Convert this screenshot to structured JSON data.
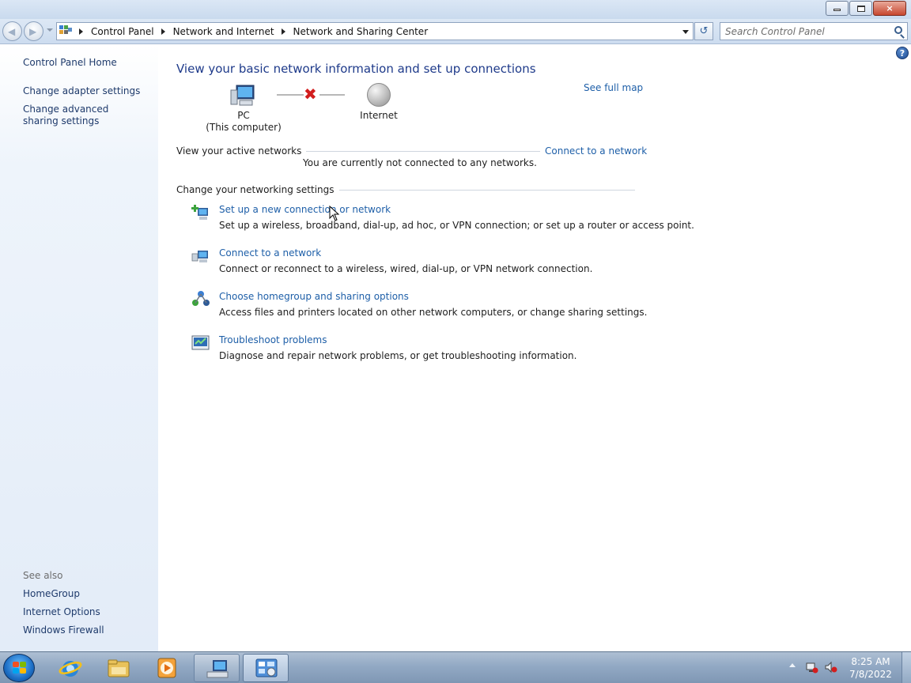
{
  "window": {
    "minimize_icon": "minimize-icon",
    "maximize_icon": "restore-icon",
    "close_label": "×"
  },
  "nav": {
    "back_icon": "back-arrow-icon",
    "forward_icon": "forward-arrow-icon",
    "breadcrumb": [
      "Control Panel",
      "Network and Internet",
      "Network and Sharing Center"
    ],
    "refresh_label": "↺",
    "search_placeholder": "Search Control Panel"
  },
  "sidebar": {
    "home": "Control Panel Home",
    "links": [
      "Change adapter settings",
      "Change advanced sharing settings"
    ],
    "see_also_label": "See also",
    "see_also": [
      "HomeGroup",
      "Internet Options",
      "Windows Firewall"
    ]
  },
  "main": {
    "help_label": "?",
    "title": "View your basic network information and set up connections",
    "see_full_map": "See full map",
    "map": {
      "pc_label": "PC",
      "pc_sublabel": "(This computer)",
      "status_icon": "✖",
      "internet_label": "Internet"
    },
    "active_networks": {
      "label": "View your active networks",
      "connect_link": "Connect to a network",
      "status": "You are currently not connected to any networks."
    },
    "settings_label": "Change your networking settings",
    "tasks": [
      {
        "icon": "new-connection-icon",
        "title": "Set up a new connection or network",
        "description": "Set up a wireless, broadband, dial-up, ad hoc, or VPN connection; or set up a router or access point."
      },
      {
        "icon": "connect-network-icon",
        "title": "Connect to a network",
        "description": "Connect or reconnect to a wireless, wired, dial-up, or VPN network connection."
      },
      {
        "icon": "homegroup-icon",
        "title": "Choose homegroup and sharing options",
        "description": "Access files and printers located on other network computers, or change sharing settings."
      },
      {
        "icon": "troubleshoot-icon",
        "title": "Troubleshoot problems",
        "description": "Diagnose and repair network problems, or get troubleshooting information."
      }
    ]
  },
  "taskbar": {
    "items": [
      "start-button",
      "internet-explorer",
      "windows-explorer",
      "media-player",
      "network-and-sharing-center",
      "control-panel"
    ],
    "clock_time": "8:25 AM",
    "clock_date": "7/8/2022"
  }
}
